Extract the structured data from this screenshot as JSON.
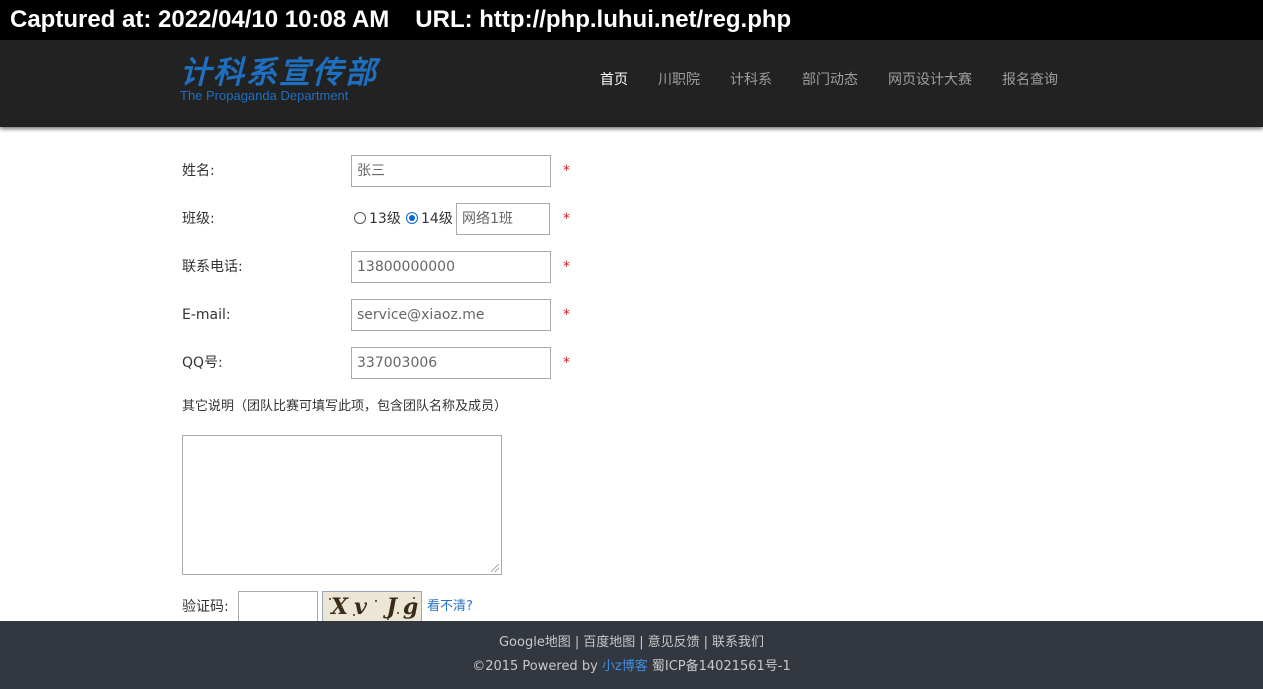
{
  "capture": {
    "captured": "Captured at: 2022/04/10 10:08 AM",
    "url": "URL: http://php.luhui.net/reg.php"
  },
  "header": {
    "logo_cn": "计科系宣传部",
    "logo_en": "The Propaganda Department",
    "nav": [
      "首页",
      "川职院",
      "计科系",
      "部门动态",
      "网页设计大赛",
      "报名查询"
    ],
    "active_nav": "首页"
  },
  "form": {
    "name_label": "姓名:",
    "name_value": "张三",
    "class_label": "班级:",
    "grade_options": [
      "13级",
      "14级"
    ],
    "grade_selected": "14级",
    "class_value": "网络1班",
    "phone_label": "联系电话:",
    "phone_value": "13800000000",
    "email_label": "E-mail:",
    "email_value": "service@xiaoz.me",
    "qq_label": "QQ号:",
    "qq_value": "337003006",
    "required_mark": "*",
    "note_label": "其它说明（团队比赛可填写此项，包含团队名称及成员）",
    "note_value": "",
    "captcha_label": "验证码:",
    "captcha_value": "",
    "captcha_text": "Xv Jg",
    "refresh_label": "看不清?"
  },
  "footer": {
    "links": [
      "Google地图",
      "百度地图",
      "意见反馈",
      "联系我们"
    ],
    "separator": "|",
    "copyright_prefix": "©2015 Powered by",
    "copyright_link": "小z博客",
    "icp": "蜀ICP备14021561号-1"
  },
  "colors": {
    "nav_bg": "#222222",
    "footer_bg": "#333840",
    "accent": "#1e6fc0",
    "required": "#e02020"
  }
}
